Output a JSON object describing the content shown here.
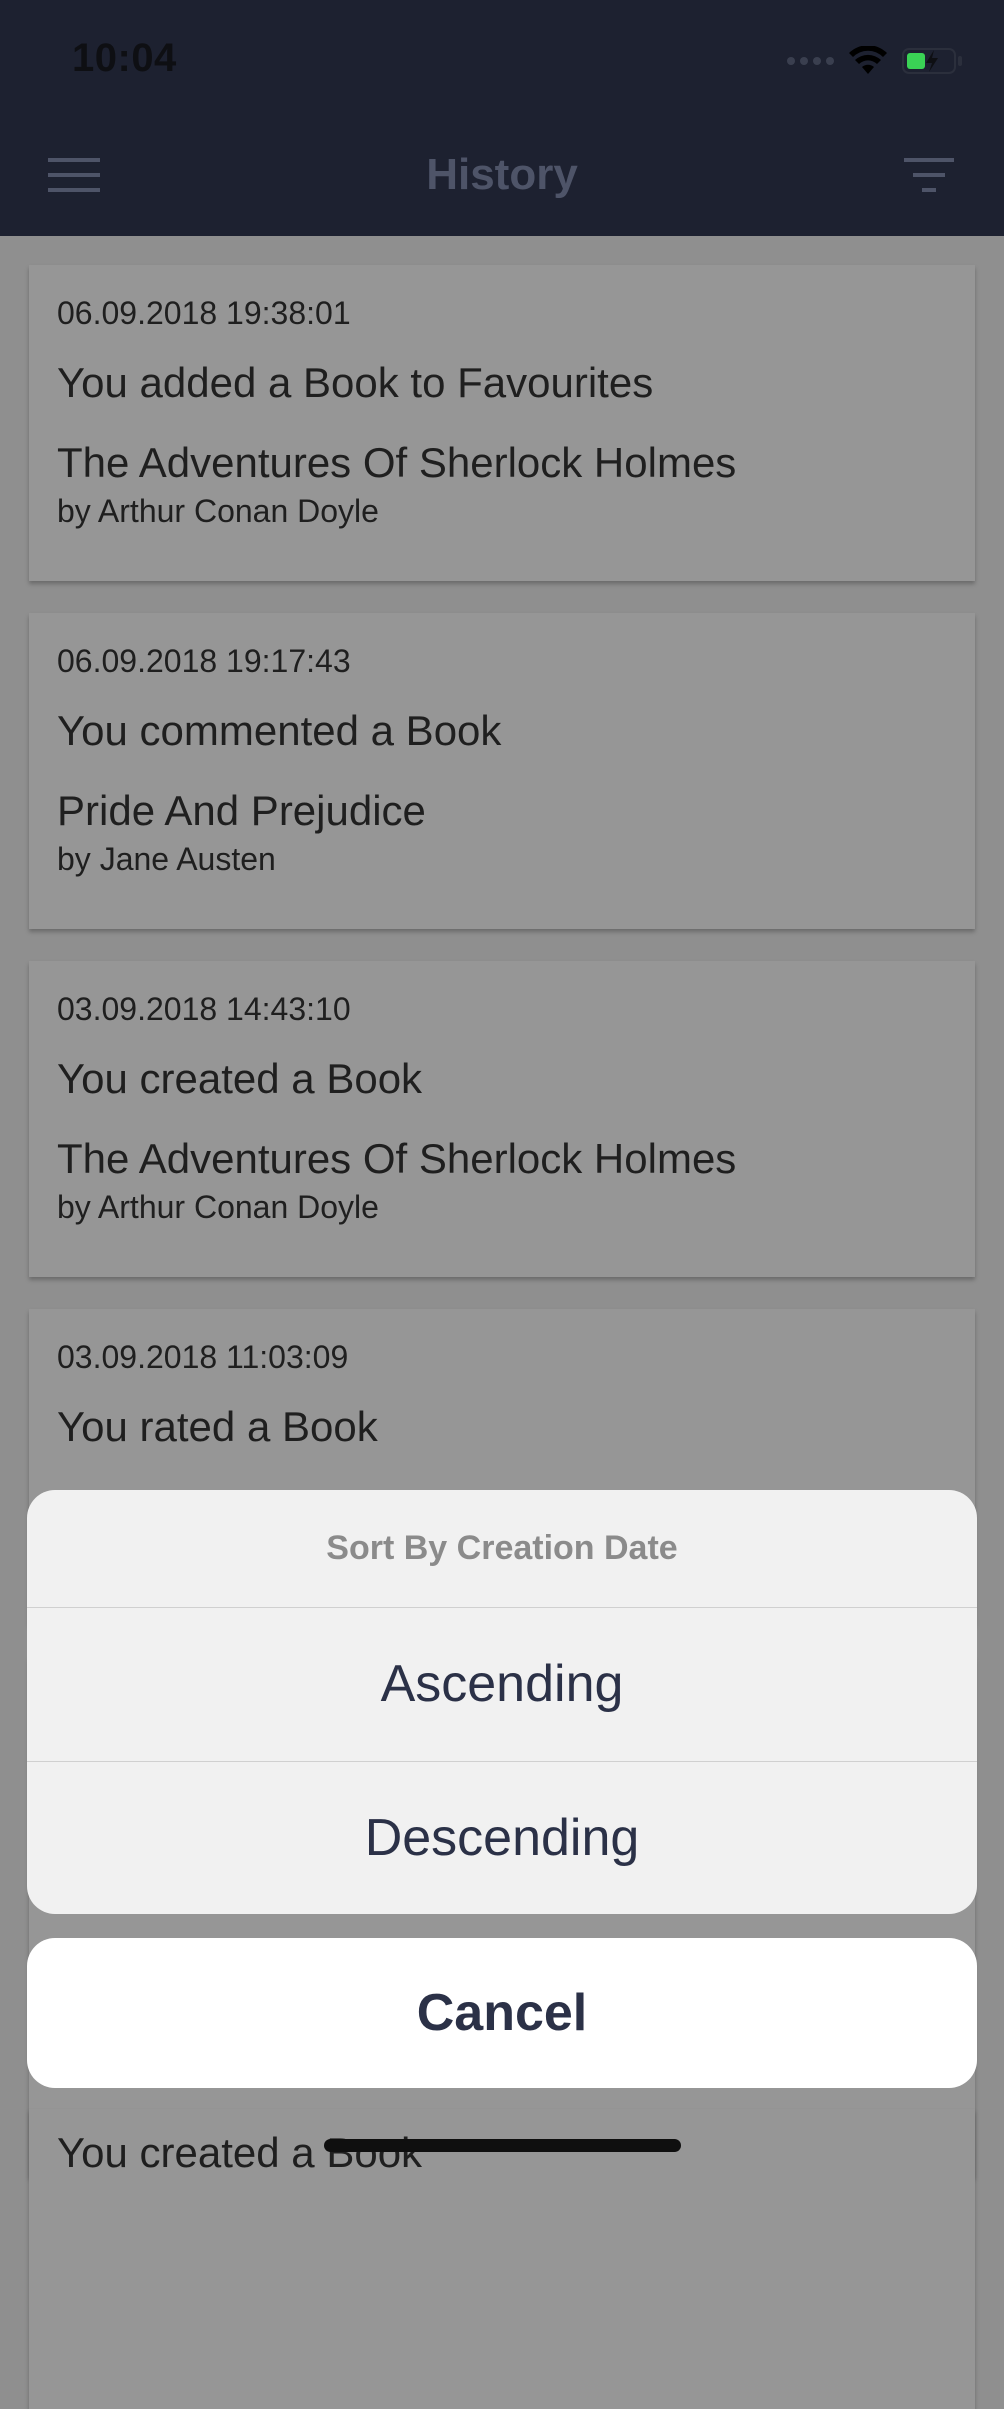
{
  "status": {
    "time": "10:04"
  },
  "nav": {
    "title": "History",
    "menu_icon": "hamburger-menu-icon",
    "filter_icon": "filter-icon"
  },
  "history": [
    {
      "date": "06.09.2018 19:38:01",
      "action": "You added a Book to Favourites",
      "book": "The Adventures Of Sherlock Holmes",
      "author": "by Arthur Conan Doyle"
    },
    {
      "date": "06.09.2018 19:17:43",
      "action": "You commented a Book",
      "book": "Pride And Prejudice",
      "author": "by Jane Austen"
    },
    {
      "date": "03.09.2018 14:43:10",
      "action": "You created a Book",
      "book": "The Adventures Of Sherlock Holmes",
      "author": "by Arthur Conan Doyle"
    },
    {
      "date": "03.09.2018 11:03:09",
      "action": "You rated a Book"
    },
    {
      "action": "You created a Book"
    }
  ],
  "sort_sheet": {
    "title": "Sort By Creation Date",
    "options": [
      "Ascending",
      "Descending"
    ],
    "cancel_label": "Cancel"
  },
  "colors": {
    "nav_bg": "#1d2130",
    "overlay_bg": "#8f8f8f",
    "accent_text": "#2b3147"
  }
}
